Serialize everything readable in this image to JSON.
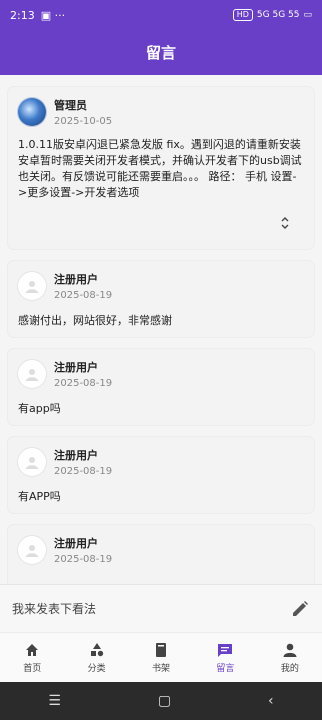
{
  "status": {
    "time": "2:13",
    "right_text": "5G 5G 55",
    "chip": "HD"
  },
  "appbar": {
    "title": "留言"
  },
  "messages": [
    {
      "name": "管理员",
      "date": "2025-10-05",
      "content": "1.0.11版安卓闪退已紧急发版 fix。遇到闪退的请重新安装 安卓暂时需要关闭开发者模式，并确认开发者下的usb调试也关闭。有反馈说可能还需要重启。。。 路径：  手机  设置->更多设置->开发者选项",
      "expand_icon": "expand-icon"
    },
    {
      "name": "注册用户",
      "date": "2025-08-19",
      "content": "感谢付出，网站很好，非常感谢"
    },
    {
      "name": "注册用户",
      "date": "2025-08-19",
      "content": "有app吗"
    },
    {
      "name": "注册用户",
      "date": "2025-08-19",
      "content": "有APP吗"
    },
    {
      "name": "注册用户",
      "date": "2025-08-19",
      "content": ""
    }
  ],
  "input": {
    "placeholder": "我来发表下看法"
  },
  "tabs": [
    {
      "label": "首页",
      "icon": "home-icon"
    },
    {
      "label": "分类",
      "icon": "category-icon"
    },
    {
      "label": "书架",
      "icon": "bookshelf-icon"
    },
    {
      "label": "留言",
      "icon": "message-icon",
      "active": true
    },
    {
      "label": "我的",
      "icon": "profile-icon"
    }
  ],
  "colors": {
    "accent": "#6a3fc8",
    "nav_bg": "#2b2b2b"
  }
}
